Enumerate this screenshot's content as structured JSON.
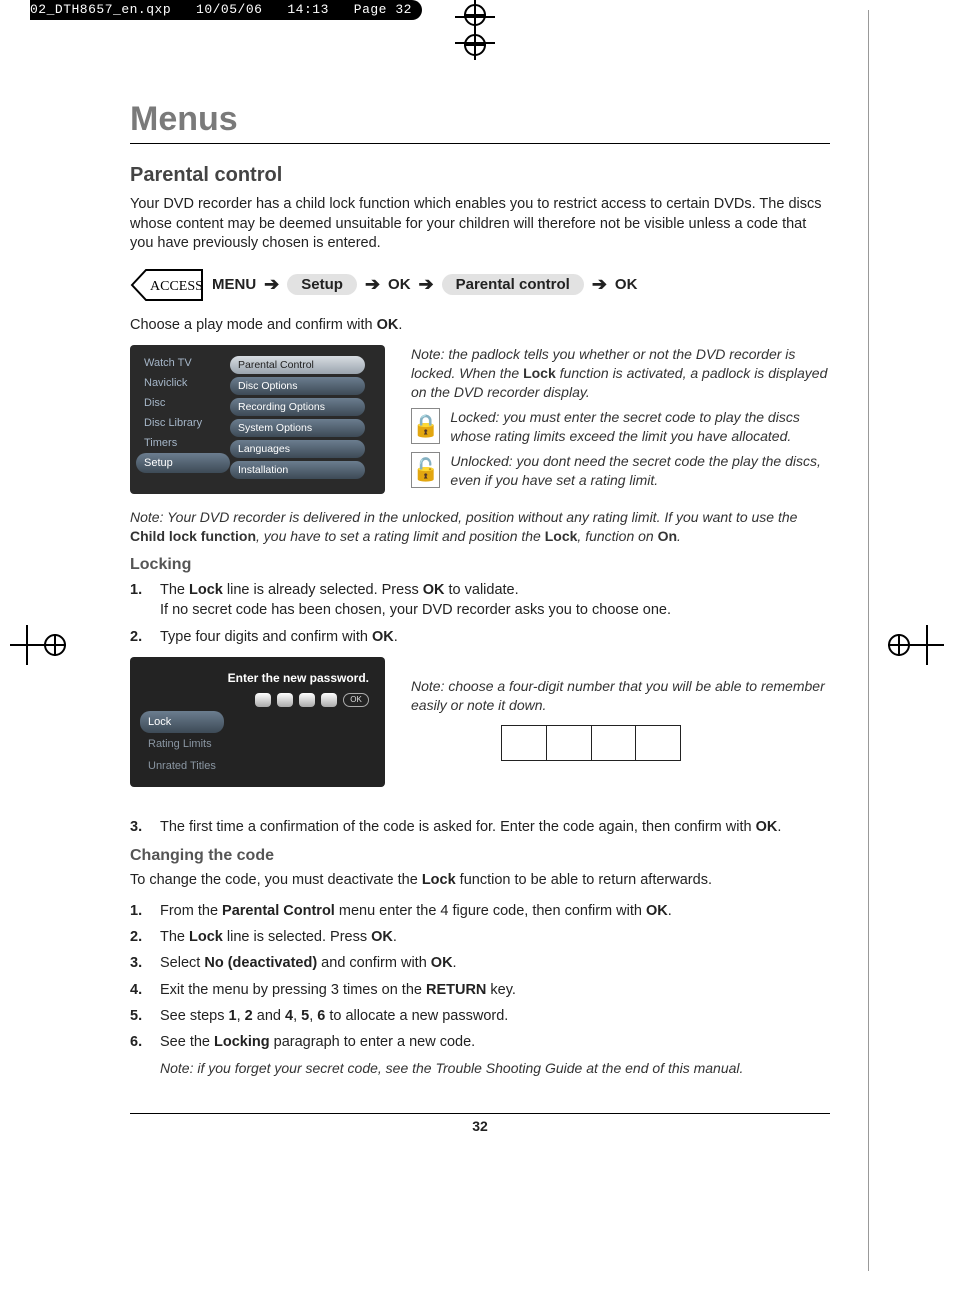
{
  "qxp": {
    "file": "02_DTH8657_en.qxp",
    "date": "10/05/06",
    "time": "14:13",
    "page_prefix": "Page",
    "page": "32"
  },
  "title": "Menus",
  "section": "Parental control",
  "intro": "Your DVD recorder has a child lock function which enables you to restrict access to certain DVDs. The discs whose content may be deemed unsuitable for your children will therefore not be visible unless a code that you have previously chosen is entered.",
  "access_word": "ACCESS",
  "breadcrumb": {
    "menu": "MENU",
    "setup": "Setup",
    "ok1": "OK",
    "pc": "Parental control",
    "ok2": "OK"
  },
  "choose_line_pre": "Choose a play mode and confirm with ",
  "choose_line_bold": "OK",
  "menu1": {
    "left": [
      "Watch TV",
      "Naviclick",
      "Disc",
      "Disc Library",
      "Timers",
      "Setup"
    ],
    "active_left": "Setup",
    "right": [
      "Parental Control",
      "Disc Options",
      "Recording Options",
      "System Options",
      "Languages",
      "Installation"
    ],
    "active_right": "Parental Control"
  },
  "note_padlock_a": "Note: the padlock tells you whether or not the DVD recorder is locked. When the ",
  "note_padlock_b": "Lock",
  "note_padlock_c": " function is activated, a padlock is displayed on the DVD recorder display.",
  "locked_note": "Locked: you must enter the secret code to play the discs whose rating limits exceed the limit you have allocated.",
  "unlocked_note": "Unlocked: you dont need the secret code the play the discs, even if you have set a rating limit.",
  "delivery_note_a": "Note: Your DVD recorder is delivered in the unlocked, position without any rating limit. If you want to use the ",
  "delivery_note_b": "Child lock function",
  "delivery_note_c": ", you have to set a rating limit and position the ",
  "delivery_note_d": "Lock",
  "delivery_note_e": ", function on ",
  "delivery_note_f": "On",
  "locking_h": "Locking",
  "lock_step1_a": "The ",
  "lock_step1_b": "Lock",
  "lock_step1_c": " line is already selected. Press ",
  "lock_step1_d": "OK",
  "lock_step1_e": " to validate.",
  "lock_step1_line2": "If no secret code has been chosen, your DVD recorder asks you to choose one.",
  "lock_step2_a": "Type four digits and confirm with ",
  "lock_step2_b": "OK",
  "panel": {
    "header": "Enter the new password.",
    "ok": "OK",
    "left": [
      "Lock",
      "Rating Limits",
      "Unrated Titles"
    ],
    "active": "Lock"
  },
  "note_four_digit": "Note: choose a four-digit number that you will be able to remember easily or note it down.",
  "lock_step3_a": "The first time a confirmation of the code is asked for. Enter the code again, then confirm with ",
  "lock_step3_b": "OK",
  "changing_h": "Changing the code",
  "changing_intro_a": "To change the code, you must deactivate the ",
  "changing_intro_b": "Lock",
  "changing_intro_c": " function to be able to return afterwards.",
  "ch1_a": "From the ",
  "ch1_b": "Parental Control",
  "ch1_c": " menu enter the 4 figure code, then confirm with ",
  "ch1_d": "OK",
  "ch2_a": "The ",
  "ch2_b": "Lock",
  "ch2_c": " line is selected. Press ",
  "ch2_d": "OK",
  "ch3_a": "Select ",
  "ch3_b": "No (deactivated)",
  "ch3_c": " and confirm with ",
  "ch3_d": "OK",
  "ch4_a": "Exit the menu by pressing 3 times on the ",
  "ch4_b": "RETURN",
  "ch4_c": " key.",
  "ch5_a": "See steps ",
  "ch5_1": "1",
  "ch5_comma1": ", ",
  "ch5_2": "2",
  "ch5_and": " and ",
  "ch5_4": "4",
  "ch5_comma2": ", ",
  "ch5_5": "5",
  "ch5_comma3": ", ",
  "ch5_6": "6",
  "ch5_end": " to allocate a new password.",
  "ch6_a": "See the ",
  "ch6_b": "Locking",
  "ch6_c": " paragraph to enter a new code.",
  "forget_note": "Note: if you forget your secret code, see the Trouble Shooting Guide at the end of this manual.",
  "page_number": "32"
}
